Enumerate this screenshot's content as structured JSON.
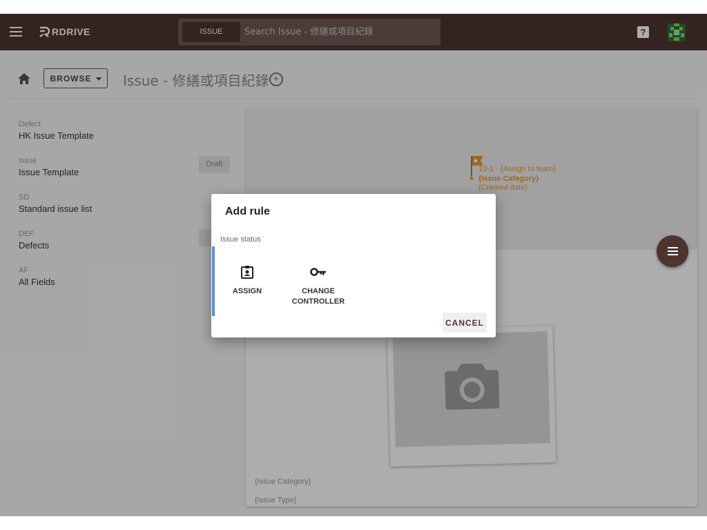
{
  "app": {
    "logo_text": "RDRIVE"
  },
  "search": {
    "tab_label": "ISSUE",
    "placeholder": "Search Issue - 修繕或項目紀錄"
  },
  "header": {
    "help_glyph": "?"
  },
  "breadcrumb": {
    "browse_label": "BROWSE",
    "title": "Issue - 修繕或項目紀錄",
    "add_glyph": "+"
  },
  "templates": [
    {
      "code": "Defect",
      "name": "HK Issue Template",
      "badge": ""
    },
    {
      "code": "Issue",
      "name": "Issue Template",
      "badge": "Draft"
    },
    {
      "code": "SD",
      "name": "Standard issue list",
      "badge": ""
    },
    {
      "code": "DEF",
      "name": "Defects",
      "badge": "D"
    },
    {
      "code": "AF",
      "name": "All Fields",
      "badge": ""
    }
  ],
  "preview": {
    "pin_line1": "10-1 - {Assign to team}",
    "pin_line2": "{Issue Category}",
    "pin_line3": "{Created date}",
    "field1": "{Issue Category}",
    "field2": "{Issue Type}"
  },
  "dialog": {
    "title": "Add rule",
    "section_label": "Issue status",
    "options": [
      {
        "label": "ASSIGN",
        "icon": "clipboard-account-icon"
      },
      {
        "label": "CHANGE CONTROLLER",
        "icon": "key-icon"
      }
    ],
    "cancel_label": "CANCEL"
  },
  "colors": {
    "brand": "#4e342e",
    "accent": "#5b8fcf",
    "pin": "#e69a35"
  }
}
